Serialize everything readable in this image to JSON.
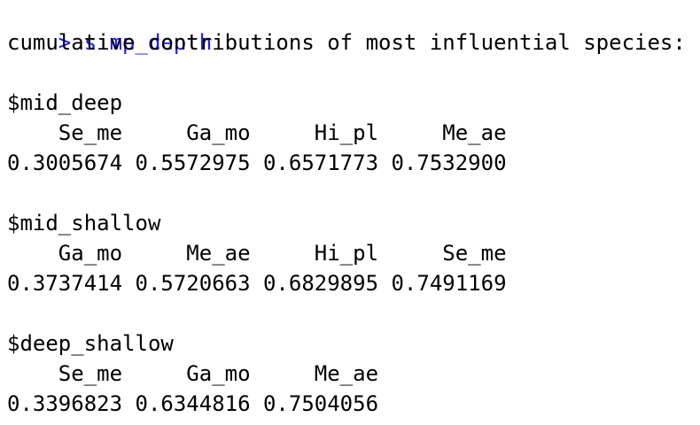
{
  "console": {
    "prompt": ">",
    "command": "simp_depth",
    "header": "cumulative contributions of most influential species:",
    "groups": [
      {
        "name": "$mid_deep",
        "species": "    Se_me     Ga_mo     Hi_pl     Me_ae",
        "values": "0.3005674 0.5572975 0.6571773 0.7532900"
      },
      {
        "name": "$mid_shallow",
        "species": "    Ga_mo     Me_ae     Hi_pl     Se_me",
        "values": "0.3737414 0.5720663 0.6829895 0.7491169"
      },
      {
        "name": "$deep_shallow",
        "species": "    Se_me     Ga_mo     Me_ae",
        "values": "0.3396823 0.6344816 0.7504056"
      }
    ]
  },
  "colors": {
    "command": "#1a1aff",
    "output": "#000000",
    "background": "#ffffff"
  }
}
